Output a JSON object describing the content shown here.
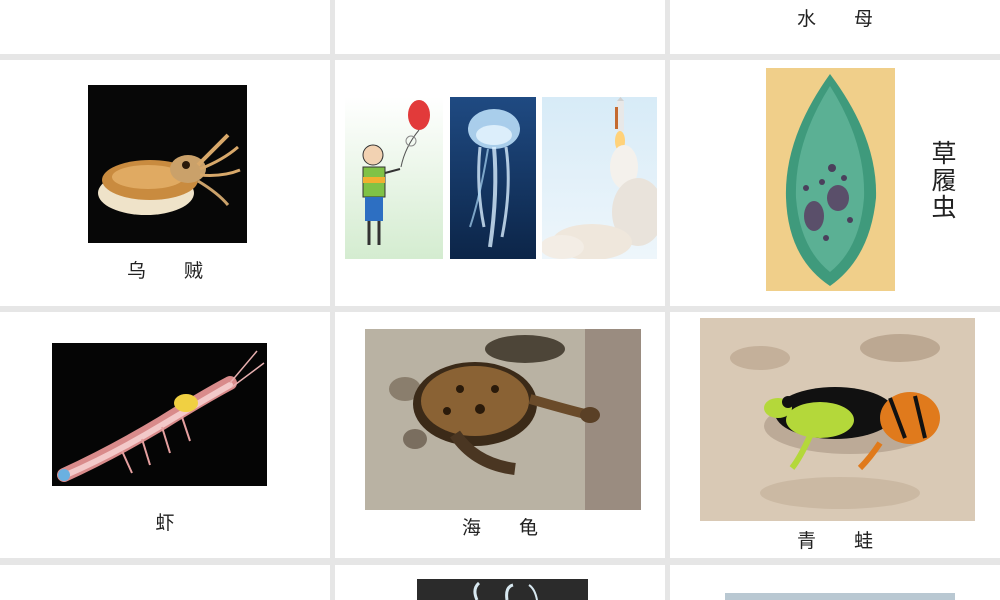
{
  "labels": {
    "jellyfish_top": "水  母",
    "cuttlefish": "乌  贼",
    "paramecium": "草履虫",
    "shrimp": "虾",
    "sea_turtle": "海  龟",
    "frog": "青  蛙"
  },
  "colors": {
    "grid_gap": "#e6e6e6",
    "cell_bg": "#ffffff"
  }
}
